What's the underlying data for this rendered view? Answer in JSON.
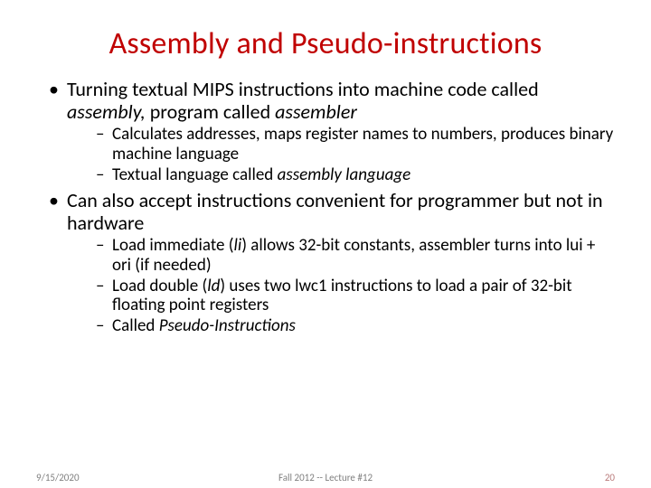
{
  "title": "Assembly and Pseudo-instructions",
  "b1": {
    "pre": "Turning textual MIPS instructions into machine code called ",
    "em1": "assembly,",
    "mid": " program called ",
    "em2": "assembler",
    "s1": "Calculates addresses, maps register names to numbers, produces binary machine language",
    "s2pre": "Textual language called ",
    "s2em": "assembly language"
  },
  "b2": {
    "text": "Can also accept instructions convenient for programmer but not in hardware",
    "s1a": "Load immediate (",
    "s1b": "li",
    "s1c": ") allows 32-bit constants, assembler turns into lui + ori (if needed)",
    "s2a": "Load double (",
    "s2b": "ld",
    "s2c": ") uses two lwc1 instructions to load a pair of 32-bit floating point registers",
    "s3a": "Called ",
    "s3b": "Pseudo-Instructions"
  },
  "footer": {
    "date": "9/15/2020",
    "center": "Fall 2012 -- Lecture #12",
    "num": "20"
  }
}
